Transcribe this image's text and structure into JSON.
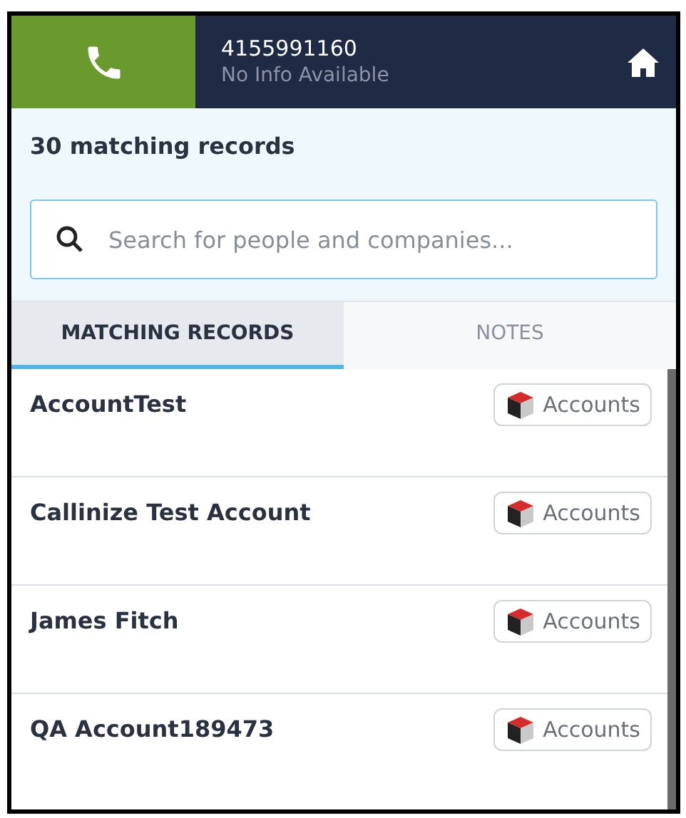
{
  "header": {
    "number": "4155991160",
    "info": "No Info Available"
  },
  "summary": "30 matching records",
  "search": {
    "placeholder": "Search for people and companies..."
  },
  "tabs": [
    {
      "label": "MATCHING RECORDS",
      "selected": true
    },
    {
      "label": "NOTES",
      "selected": false
    }
  ],
  "records": [
    {
      "name": "AccountTest",
      "type": "Accounts"
    },
    {
      "name": "Callinize Test Account",
      "type": "Accounts"
    },
    {
      "name": "James Fitch",
      "type": "Accounts"
    },
    {
      "name": "QA Account189473",
      "type": "Accounts"
    }
  ]
}
